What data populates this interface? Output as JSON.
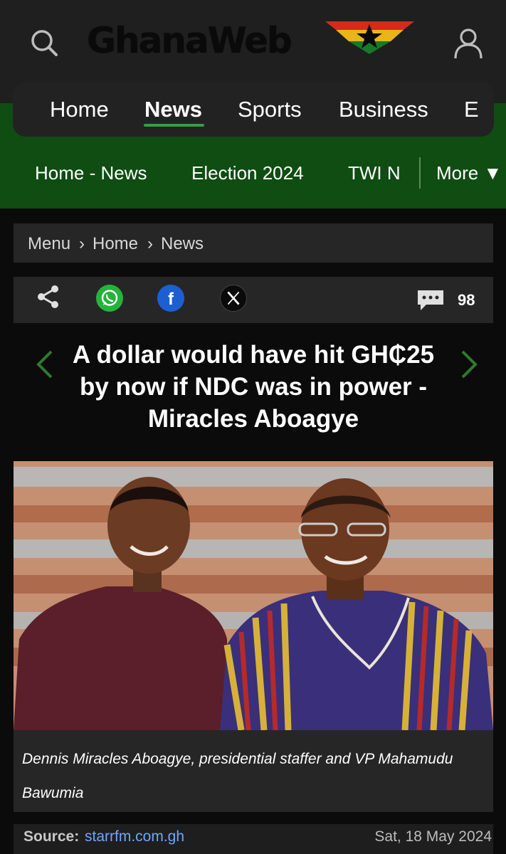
{
  "header": {
    "logo_text": "GhanaWeb"
  },
  "main_nav": {
    "items": [
      "Home",
      "News",
      "Sports",
      "Business",
      "E"
    ],
    "active": "News"
  },
  "sub_nav": {
    "items": [
      "Home - News",
      "Election 2024",
      "TWI N",
      "More ▼"
    ]
  },
  "breadcrumb": {
    "menu": "Menu",
    "separator": "›",
    "home": "Home",
    "news": "News"
  },
  "share": {
    "comment_count": "98"
  },
  "article": {
    "title": "A dollar would have hit GH₵25 by now if NDC was in power - Miracles Aboagye",
    "caption": "Dennis Miracles Aboagye, presidential staffer and VP Mahamudu Bawumia",
    "source_label": "Source:",
    "source_name": "starrfm.com.gh",
    "date": "Sat, 18 May 2024"
  },
  "colors": {
    "header_bg": "#1f1f1f",
    "green_band": "#0f4d12",
    "nav_bg": "#222222",
    "accent_green": "#3d9a3d",
    "link_blue": "#6ea6ff",
    "whatsapp": "#25b33b",
    "facebook": "#1d5fd3"
  },
  "icons": [
    "search-icon",
    "user-icon",
    "share-icon",
    "whatsapp-icon",
    "facebook-icon",
    "x-icon",
    "comment-icon",
    "chevron-left-icon",
    "chevron-right-icon"
  ]
}
